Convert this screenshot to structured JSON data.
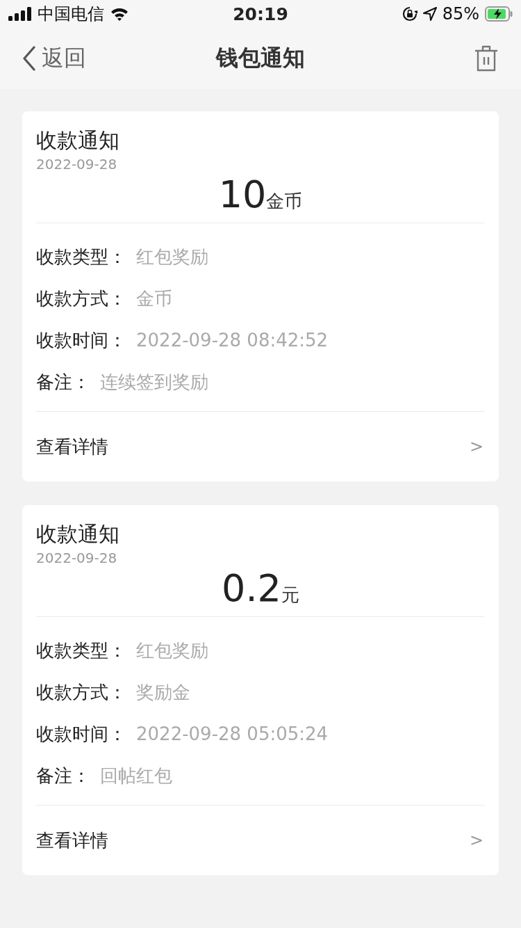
{
  "status_bar": {
    "carrier": "中国电信",
    "time": "20:19",
    "battery": "85%"
  },
  "nav": {
    "back": "返回",
    "title": "钱包通知"
  },
  "notices": [
    {
      "title": "收款通知",
      "date": "2022-09-28",
      "amount": "10",
      "unit": "金币",
      "fields": [
        {
          "label": "收款类型：",
          "value": "红包奖励"
        },
        {
          "label": "收款方式：",
          "value": "金币"
        },
        {
          "label": "收款时间：",
          "value": "2022-09-28 08:42:52"
        },
        {
          "label": "备注：",
          "value": "连续签到奖励"
        }
      ],
      "link": "查看详情",
      "arrow": ">"
    },
    {
      "title": "收款通知",
      "date": "2022-09-28",
      "amount": "0.2",
      "unit": "元",
      "fields": [
        {
          "label": "收款类型：",
          "value": "红包奖励"
        },
        {
          "label": "收款方式：",
          "value": "奖励金"
        },
        {
          "label": "收款时间：",
          "value": "2022-09-28 05:05:24"
        },
        {
          "label": "备注：",
          "value": "回帖红包"
        }
      ],
      "link": "查看详情",
      "arrow": ">"
    }
  ]
}
